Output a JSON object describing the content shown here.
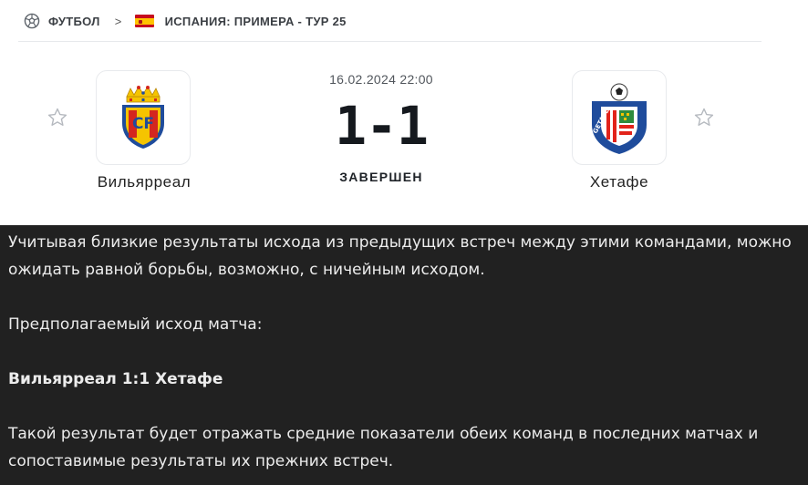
{
  "breadcrumb": {
    "sport": "ФУТБОЛ",
    "separator": ">",
    "tournament": "ИСПАНИЯ: ПРИМЕРА - ТУР 25"
  },
  "match": {
    "datetime": "16.02.2024 22:00",
    "score": "1-1",
    "status": "ЗАВЕРШЕН",
    "home": {
      "name": "Вильярреал",
      "logo": "villarreal-crest"
    },
    "away": {
      "name": "Хетафе",
      "logo": "getafe-crest"
    }
  },
  "analysis": {
    "intro": "Учитывая близкие результаты исхода из предыдущих встреч между этими командами, можно ожидать равной борьбы, возможно, с ничейным исходом.",
    "prediction_label": "Предполагаемый исход матча:",
    "prediction": "Вильярреал 1:1 Хетафе",
    "conclusion": "Такой результат будет отражать средние показатели обеих команд в последних матчах и сопоставимые результаты их прежних встреч."
  },
  "colors": {
    "panel_bg": "#212121",
    "villarreal_yellow": "#f5c400",
    "getafe_blue": "#1f4c9c",
    "spain_red": "#c60b1e",
    "spain_yellow": "#ffc400"
  }
}
